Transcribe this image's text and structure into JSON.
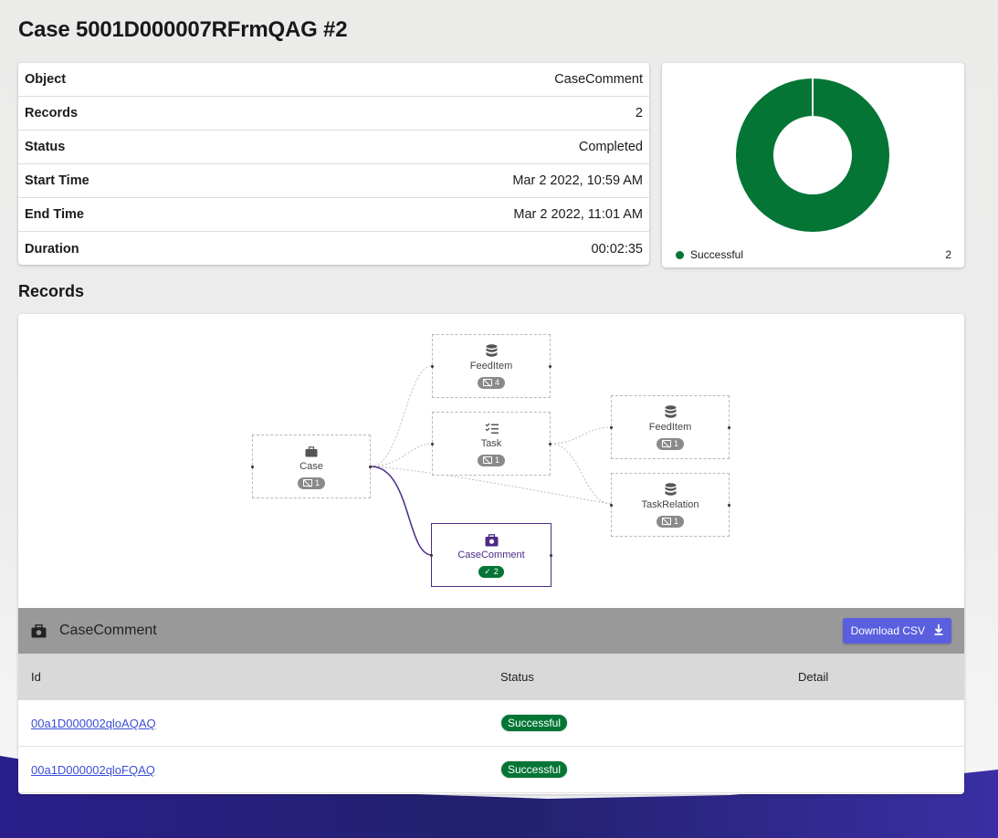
{
  "page": {
    "title": "Case 5001D000007RFrmQAG #2"
  },
  "summary": {
    "rows": [
      {
        "label": "Object",
        "value": "CaseComment"
      },
      {
        "label": "Records",
        "value": "2"
      },
      {
        "label": "Status",
        "value": "Completed"
      },
      {
        "label": "Start Time",
        "value": "Mar 2 2022, 10:59 AM"
      },
      {
        "label": "End Time",
        "value": "Mar 2 2022, 11:01 AM"
      },
      {
        "label": "Duration",
        "value": "00:02:35"
      }
    ]
  },
  "chart_data": {
    "type": "pie",
    "categories": [
      "Successful"
    ],
    "values": [
      2
    ],
    "colors": [
      "#047535"
    ],
    "legend_position": "bottom"
  },
  "records": {
    "title": "Records",
    "graph": {
      "nodes": [
        {
          "label": "Case",
          "count": "1",
          "icon": "briefcase-icon"
        },
        {
          "label": "FeedItem",
          "count": "4",
          "icon": "database-icon"
        },
        {
          "label": "Task",
          "count": "1",
          "icon": "checklist-icon"
        },
        {
          "label": "CaseComment",
          "count": "2",
          "icon": "case-comment-icon",
          "status": "success"
        },
        {
          "label": "FeedItem",
          "count": "1",
          "icon": "database-icon"
        },
        {
          "label": "TaskRelation",
          "count": "1",
          "icon": "database-icon"
        }
      ]
    },
    "detail": {
      "title": "CaseComment",
      "download_label": "Download CSV",
      "columns": [
        "Id",
        "Status",
        "Detail"
      ],
      "rows": [
        {
          "id": "00a1D000002qloAQAQ",
          "status": "Successful",
          "detail": ""
        },
        {
          "id": "00a1D000002qloFQAQ",
          "status": "Successful",
          "detail": ""
        }
      ]
    }
  },
  "colors": {
    "success": "#047535",
    "accent": "#5a5fe0",
    "selected": "#4c2a86"
  }
}
